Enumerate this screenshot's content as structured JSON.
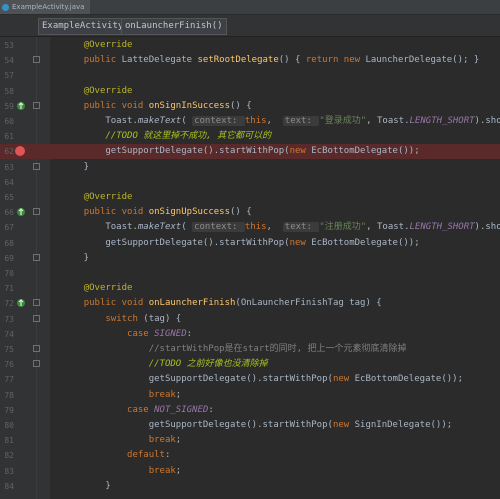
{
  "file_tab": "ExampleActivity.java",
  "breadcrumbs": [
    "ExampleActivity",
    "onLauncherFinish()"
  ],
  "lines": [
    {
      "n": "53",
      "tokens": [
        {
          "t": "    "
        },
        {
          "t": "@Override",
          "c": "ann"
        }
      ]
    },
    {
      "n": "54",
      "fold": true,
      "tokens": [
        {
          "t": "    "
        },
        {
          "t": "public ",
          "c": "kw"
        },
        {
          "t": "LatteDelegate "
        },
        {
          "t": "setRootDelegate",
          "c": "fn"
        },
        {
          "t": "() { "
        },
        {
          "t": "return new ",
          "c": "kw"
        },
        {
          "t": "LauncherDelegate(); }"
        }
      ]
    },
    {
      "n": "57",
      "tokens": []
    },
    {
      "n": "58",
      "tokens": [
        {
          "t": "    "
        },
        {
          "t": "@Override",
          "c": "ann"
        }
      ]
    },
    {
      "n": "59",
      "gicon": true,
      "fold": true,
      "tokens": [
        {
          "t": "    "
        },
        {
          "t": "public void ",
          "c": "kw"
        },
        {
          "t": "onSignInSuccess",
          "c": "fn"
        },
        {
          "t": "() {"
        }
      ]
    },
    {
      "n": "60",
      "tokens": [
        {
          "t": "        Toast."
        },
        {
          "t": "makeText",
          "c": "italic"
        },
        {
          "t": "( "
        },
        {
          "t": "context: ",
          "c": "hint"
        },
        {
          "t": "this",
          "c": "kw"
        },
        {
          "t": ",  "
        },
        {
          "t": "text: ",
          "c": "hint"
        },
        {
          "t": "\"登录成功\"",
          "c": "str"
        },
        {
          "t": ", Toast."
        },
        {
          "t": "LENGTH_SHORT",
          "c": "static"
        },
        {
          "t": ").show();"
        }
      ]
    },
    {
      "n": "61",
      "tokens": [
        {
          "t": "        "
        },
        {
          "t": "//TODO 就这里掉不成功, 其它都可以的",
          "c": "todo"
        }
      ]
    },
    {
      "n": "62",
      "err": true,
      "bp": true,
      "tokens": [
        {
          "t": "        getSupportDelegate().startWithPop("
        },
        {
          "t": "new ",
          "c": "kw"
        },
        {
          "t": "EcBottomDelegate());"
        }
      ]
    },
    {
      "n": "63",
      "fold": true,
      "tokens": [
        {
          "t": "    }"
        }
      ]
    },
    {
      "n": "64",
      "tokens": []
    },
    {
      "n": "65",
      "tokens": [
        {
          "t": "    "
        },
        {
          "t": "@Override",
          "c": "ann"
        }
      ]
    },
    {
      "n": "66",
      "gicon": true,
      "fold": true,
      "tokens": [
        {
          "t": "    "
        },
        {
          "t": "public void ",
          "c": "kw"
        },
        {
          "t": "onSignUpSuccess",
          "c": "fn"
        },
        {
          "t": "() {"
        }
      ]
    },
    {
      "n": "67",
      "tokens": [
        {
          "t": "        Toast."
        },
        {
          "t": "makeText",
          "c": "italic"
        },
        {
          "t": "( "
        },
        {
          "t": "context: ",
          "c": "hint"
        },
        {
          "t": "this",
          "c": "kw"
        },
        {
          "t": ",  "
        },
        {
          "t": "text: ",
          "c": "hint"
        },
        {
          "t": "\"注册成功\"",
          "c": "str"
        },
        {
          "t": ", Toast."
        },
        {
          "t": "LENGTH_SHORT",
          "c": "static"
        },
        {
          "t": ").show();"
        }
      ]
    },
    {
      "n": "68",
      "tokens": [
        {
          "t": "        getSupportDelegate().startWithPop("
        },
        {
          "t": "new ",
          "c": "kw"
        },
        {
          "t": "EcBottomDelegate());"
        }
      ]
    },
    {
      "n": "69",
      "fold": true,
      "tokens": [
        {
          "t": "    }"
        }
      ]
    },
    {
      "n": "70",
      "tokens": []
    },
    {
      "n": "71",
      "tokens": [
        {
          "t": "    "
        },
        {
          "t": "@Override",
          "c": "ann"
        }
      ]
    },
    {
      "n": "72",
      "gicon": true,
      "fold": true,
      "tokens": [
        {
          "t": "    "
        },
        {
          "t": "public void ",
          "c": "kw"
        },
        {
          "t": "onLauncherFinish",
          "c": "fn"
        },
        {
          "t": "(OnLauncherFinishTag tag) {"
        }
      ]
    },
    {
      "n": "73",
      "fold": true,
      "tokens": [
        {
          "t": "        "
        },
        {
          "t": "switch ",
          "c": "kw"
        },
        {
          "t": "(tag) {"
        }
      ]
    },
    {
      "n": "74",
      "tokens": [
        {
          "t": "            "
        },
        {
          "t": "case ",
          "c": "kw"
        },
        {
          "t": "SIGNED",
          "c": "static"
        },
        {
          "t": ":"
        }
      ]
    },
    {
      "n": "75",
      "fold": true,
      "tokens": [
        {
          "t": "                "
        },
        {
          "t": "//startWithPop是在start的同时, 把上一个元素彻底清除掉",
          "c": "cmt"
        }
      ]
    },
    {
      "n": "76",
      "fold": true,
      "tokens": [
        {
          "t": "                "
        },
        {
          "t": "//TODO 之前好像也没清除掉",
          "c": "todo"
        }
      ]
    },
    {
      "n": "77",
      "tokens": [
        {
          "t": "                getSupportDelegate().startWithPop("
        },
        {
          "t": "new ",
          "c": "kw"
        },
        {
          "t": "EcBottomDelegate());"
        }
      ]
    },
    {
      "n": "78",
      "tokens": [
        {
          "t": "                "
        },
        {
          "t": "break",
          "c": "kw"
        },
        {
          "t": ";"
        }
      ]
    },
    {
      "n": "79",
      "tokens": [
        {
          "t": "            "
        },
        {
          "t": "case ",
          "c": "kw"
        },
        {
          "t": "NOT_SIGNED",
          "c": "static"
        },
        {
          "t": ":"
        }
      ]
    },
    {
      "n": "80",
      "tokens": [
        {
          "t": "                getSupportDelegate().startWithPop("
        },
        {
          "t": "new ",
          "c": "kw"
        },
        {
          "t": "SignInDelegate());"
        }
      ]
    },
    {
      "n": "81",
      "tokens": [
        {
          "t": "                "
        },
        {
          "t": "break",
          "c": "kw"
        },
        {
          "t": ";"
        }
      ]
    },
    {
      "n": "82",
      "tokens": [
        {
          "t": "            "
        },
        {
          "t": "default",
          "c": "kw"
        },
        {
          "t": ":"
        }
      ]
    },
    {
      "n": "83",
      "tokens": [
        {
          "t": "                "
        },
        {
          "t": "break",
          "c": "kw"
        },
        {
          "t": ";"
        }
      ]
    },
    {
      "n": "84",
      "tokens": [
        {
          "t": "        }"
        }
      ]
    }
  ],
  "colors": {
    "background": "#2b2b2b",
    "gutter": "#313335",
    "error_line": "#5a2a2a",
    "breakpoint": "#e05555",
    "keyword": "#cc7832",
    "annotation": "#bbb529",
    "method": "#ffc66d",
    "string": "#6a8759",
    "todo": "#a8c023"
  },
  "icons": {
    "override": "override-arrow-icon",
    "breakpoint": "breakpoint-icon",
    "fold": "fold-marker-icon",
    "file": "java-file-icon"
  }
}
